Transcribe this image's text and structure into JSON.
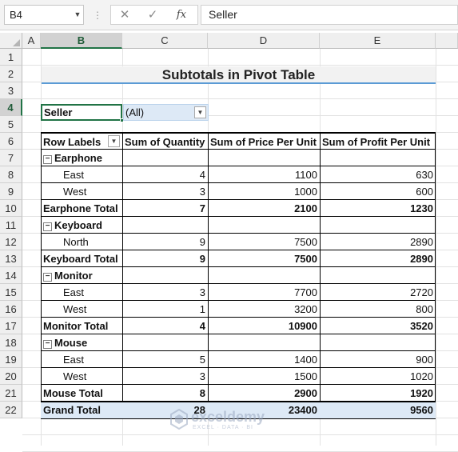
{
  "formula_bar": {
    "name_box": "B4",
    "cancel_glyph": "✕",
    "enter_glyph": "✓",
    "fx_label": "fx",
    "content": "Seller"
  },
  "columns": [
    "A",
    "B",
    "C",
    "D",
    "E"
  ],
  "rows": [
    "1",
    "2",
    "3",
    "4",
    "5",
    "6",
    "7",
    "8",
    "9",
    "10",
    "11",
    "12",
    "13",
    "14",
    "15",
    "16",
    "17",
    "18",
    "19",
    "20",
    "21",
    "22"
  ],
  "selected_cell": {
    "column": "B",
    "row": "4"
  },
  "title": "Subtotals in Pivot Table",
  "filter": {
    "label": "Seller",
    "value": "(All)"
  },
  "pivot": {
    "headers": [
      "Row Labels",
      "Sum of Quantity",
      "Sum of Price Per Unit",
      "Sum of Profit Per Unit"
    ],
    "groups": [
      {
        "name": "Earphone",
        "items": [
          {
            "label": "East",
            "qty": "4",
            "price": "1100",
            "profit": "630"
          },
          {
            "label": "West",
            "qty": "3",
            "price": "1000",
            "profit": "600"
          }
        ],
        "total": {
          "label": "Earphone Total",
          "qty": "7",
          "price": "2100",
          "profit": "1230"
        }
      },
      {
        "name": "Keyboard",
        "items": [
          {
            "label": "North",
            "qty": "9",
            "price": "7500",
            "profit": "2890"
          }
        ],
        "total": {
          "label": "Keyboard Total",
          "qty": "9",
          "price": "7500",
          "profit": "2890"
        }
      },
      {
        "name": "Monitor",
        "items": [
          {
            "label": "East",
            "qty": "3",
            "price": "7700",
            "profit": "2720"
          },
          {
            "label": "West",
            "qty": "1",
            "price": "3200",
            "profit": "800"
          }
        ],
        "total": {
          "label": "Monitor Total",
          "qty": "4",
          "price": "10900",
          "profit": "3520"
        }
      },
      {
        "name": "Mouse",
        "items": [
          {
            "label": "East",
            "qty": "5",
            "price": "1400",
            "profit": "900"
          },
          {
            "label": "West",
            "qty": "3",
            "price": "1500",
            "profit": "1020"
          }
        ],
        "total": {
          "label": "Mouse Total",
          "qty": "8",
          "price": "2900",
          "profit": "1920"
        }
      }
    ],
    "grand_total": {
      "label": "Grand Total",
      "qty": "28",
      "price": "23400",
      "profit": "9560"
    }
  },
  "watermark": {
    "name": "exceldemy",
    "tagline": "EXCEL · DATA · BI"
  },
  "colors": {
    "accent_green": "#217346",
    "title_underline": "#5b9bd5",
    "grand_total_fill": "#dde9f6"
  }
}
